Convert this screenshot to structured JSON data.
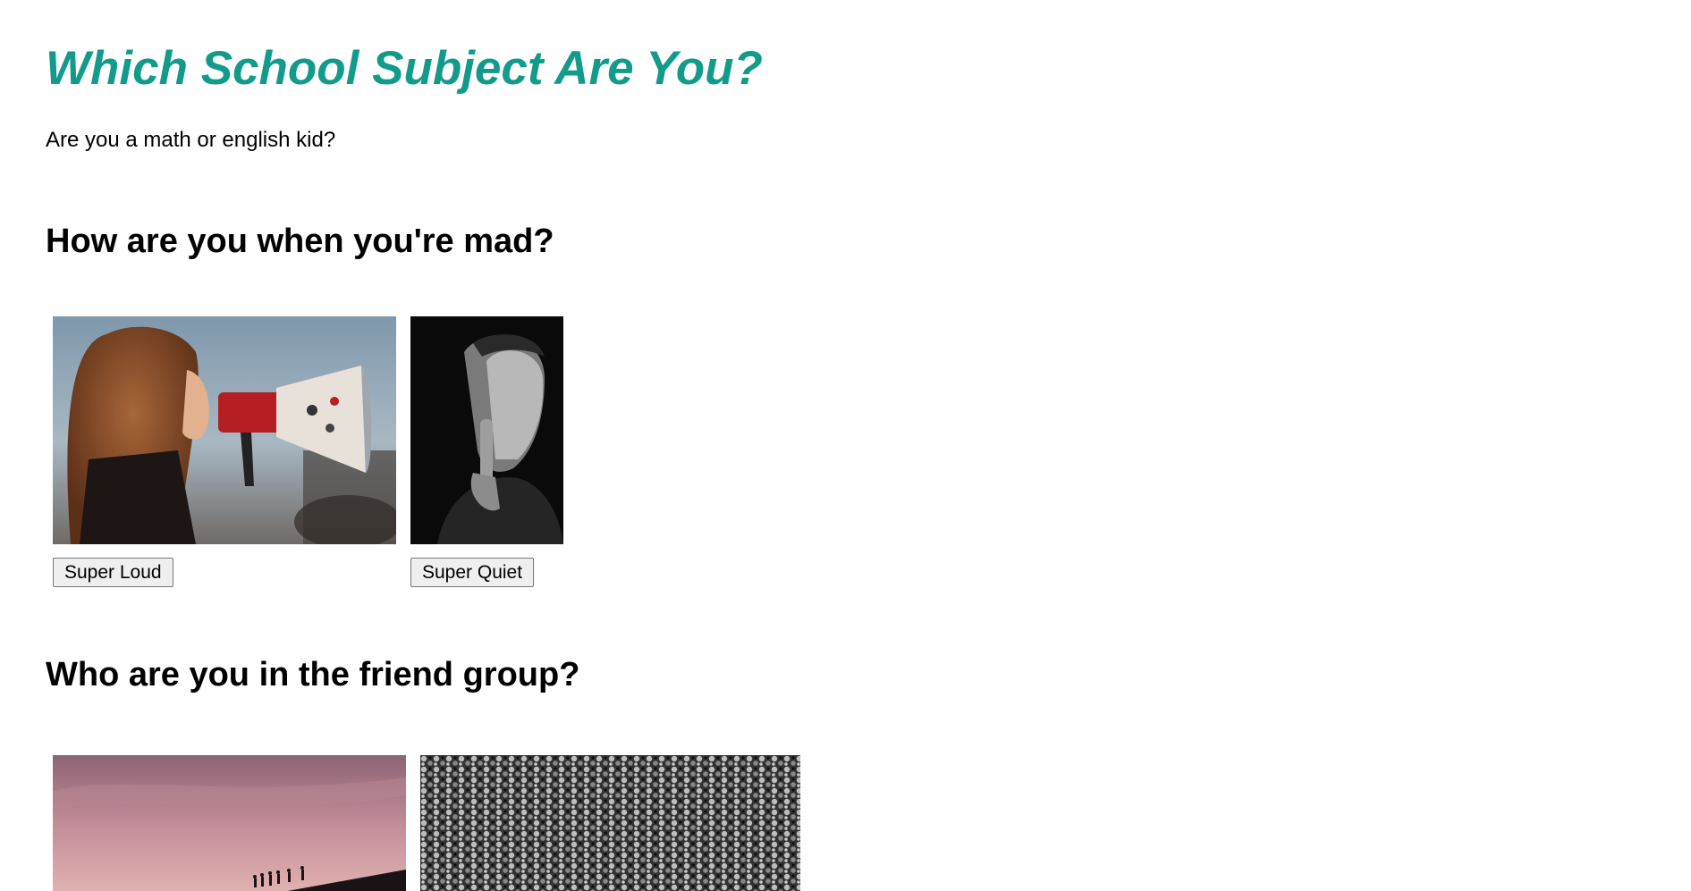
{
  "header": {
    "title": "Which School Subject Are You?",
    "subtitle": "Are you a math or english kid?"
  },
  "questions": [
    {
      "text": "How are you when you're mad?",
      "options": [
        {
          "label": "Super Loud",
          "image": "woman-with-megaphone"
        },
        {
          "label": "Super Quiet",
          "image": "man-shushing"
        }
      ]
    },
    {
      "text": "Who are you in the friend group?",
      "options": [
        {
          "image": "silhouettes-on-hill-at-dusk"
        },
        {
          "image": "large-crowd-black-and-white"
        }
      ]
    }
  ],
  "colors": {
    "title": "#129b8b",
    "button_bg": "#efefef",
    "button_border": "#767676"
  }
}
